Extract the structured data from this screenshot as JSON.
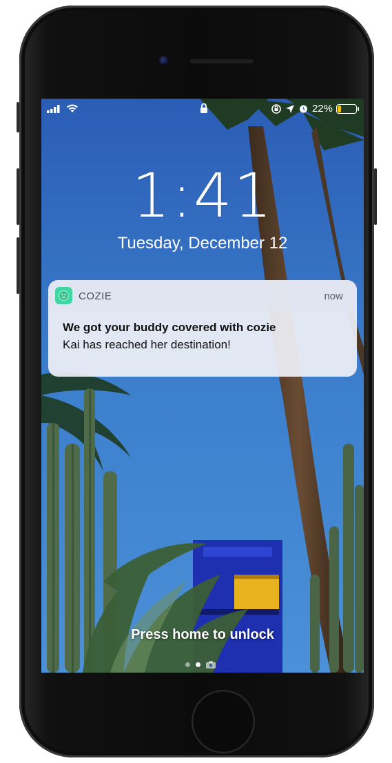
{
  "status_bar": {
    "signal_icon": "cellular-signal-icon",
    "wifi_icon": "wifi-icon",
    "lock_icon": "lock-icon",
    "right_icons": [
      "orientation-lock-icon",
      "location-arrow-icon",
      "alarm-icon"
    ],
    "battery_percent": "22%",
    "battery_level": 0.22,
    "battery_color": "#f5c400"
  },
  "lock_screen": {
    "time": "1:41",
    "date": "Tuesday, December 12",
    "unlock_hint": "Press home to unlock",
    "page_indicator": {
      "pages": 2,
      "active": 1,
      "camera_icon": "camera-icon"
    }
  },
  "notification": {
    "app_name": "COZIE",
    "app_icon": "cozie-app-icon",
    "app_color": "#3fd7a1",
    "time": "now",
    "title": "We got your buddy covered with cozie",
    "body": "Kai has reached her destination!"
  }
}
